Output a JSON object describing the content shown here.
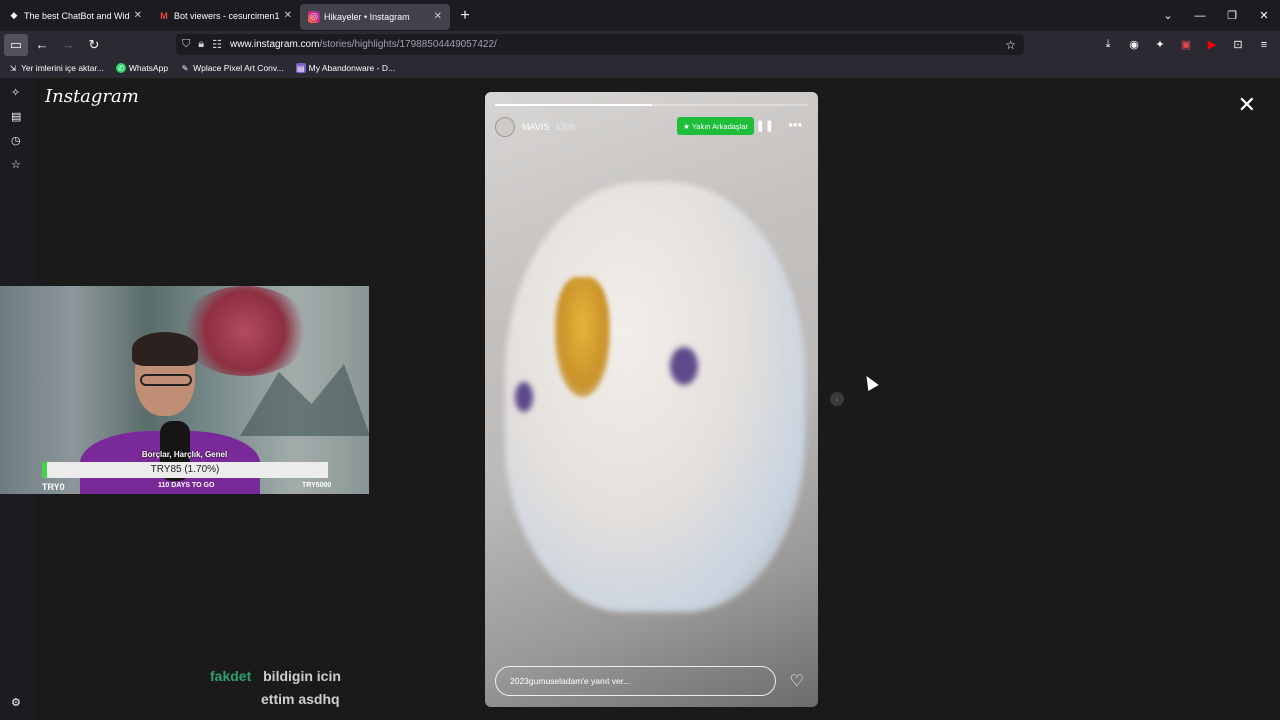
{
  "tabs": [
    {
      "label": "The best ChatBot and Widgets",
      "icon": "diamond-icon"
    },
    {
      "label": "Bot viewers - cesurcimen17@g",
      "icon": "gmail-icon"
    },
    {
      "label": "Hikayeler • Instagram",
      "icon": "instagram-icon"
    }
  ],
  "url": {
    "domain": "www.instagram.com",
    "path": "/stories/highlights/17988504449057422/"
  },
  "bookmarks": [
    {
      "label": "Yer imlerini içe aktar...",
      "icon": "import-icon"
    },
    {
      "label": "WhatsApp",
      "icon": "whatsapp-icon"
    },
    {
      "label": "Wplace Pixel Art Conv...",
      "icon": "pencil-icon"
    },
    {
      "label": "My Abandonware - D...",
      "icon": "abandonware-icon"
    }
  ],
  "instagram": {
    "logo": "Instagram"
  },
  "story": {
    "username": "MAVIS",
    "time": "130h",
    "close_friends": "Yakın Arkadaşlar",
    "reply_placeholder": "2023gumuseladam'e yanıt ver...",
    "progress": 0.5
  },
  "webcam": {
    "donation_title": "Borçlar, Harçlık, Genel",
    "donation_value": "TRY85 (1.70%)",
    "donation_fraction": 0.017,
    "left_label": "TRY0",
    "days_label": "110 DAYS TO GO",
    "right_label": "TRY5000"
  },
  "chat": {
    "user": "fakdet",
    "line1": "bildigin icin",
    "line2": "ettim asdhq"
  },
  "colors": {
    "accent_green": "#1ebe3b",
    "chat_user": "#2fa06a",
    "shirt": "#7a2a98"
  }
}
